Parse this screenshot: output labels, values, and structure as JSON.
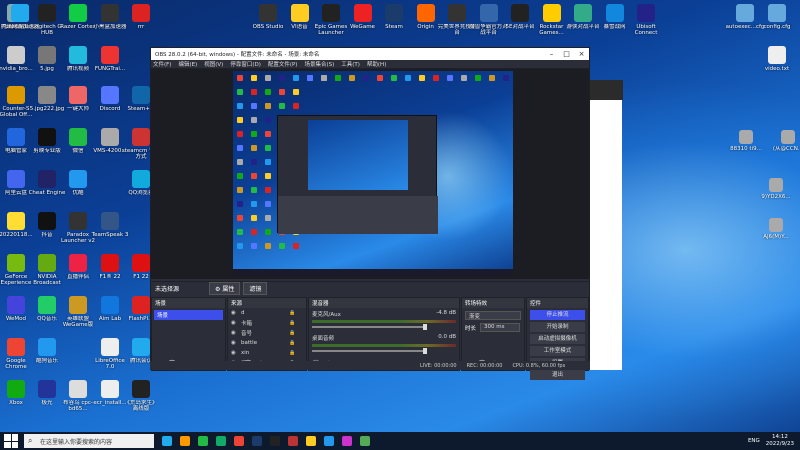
{
  "desktop": {
    "icons": [
      {
        "label": "回收站",
        "x": 0,
        "y": 2,
        "c": "#8aa"
      },
      {
        "label": "Logitech G HUB",
        "x": 1,
        "y": 2,
        "c": "#222"
      },
      {
        "label": "Razer Cortex",
        "x": 2,
        "y": 2,
        "c": "#1c4"
      },
      {
        "label": "小黑盒加速器",
        "x": 3,
        "y": 2,
        "c": "#333"
      },
      {
        "label": "rrr",
        "x": 4,
        "y": 2,
        "c": "#d22"
      },
      {
        "label": "promods...",
        "x": 5,
        "y": 2,
        "c": "#eee"
      },
      {
        "label": "腾讯网游加速器",
        "x": 6,
        "y": 2,
        "c": "#2ae"
      },
      {
        "label": "nvidia_bro...",
        "x": 0,
        "y": 1,
        "c": "#ccc"
      },
      {
        "label": "5.jpg",
        "x": 1,
        "y": 1,
        "c": "#777"
      },
      {
        "label": "腾讯视频",
        "x": 2,
        "y": 1,
        "c": "#2bd"
      },
      {
        "label": "FUNGTrai...",
        "x": 3,
        "y": 1,
        "c": "#e33"
      },
      {
        "label": "Counter-S Global Off...",
        "x": 0,
        "y": 0,
        "c": "#d90"
      },
      {
        "label": "5.jpg222.jpg",
        "x": 1,
        "y": 0,
        "c": "#888"
      },
      {
        "label": "一键大师",
        "x": 2,
        "y": 0,
        "c": "#e66"
      },
      {
        "label": "Discord",
        "x": 3,
        "y": 0,
        "c": "#57f"
      },
      {
        "label": "Steam++",
        "x": 4,
        "y": 0,
        "c": "#16a"
      },
      {
        "label": "电脑管家",
        "x": 0,
        "y": 3,
        "c": "#26d"
      },
      {
        "label": "剪映专业版",
        "x": 1,
        "y": 3,
        "c": "#111"
      },
      {
        "label": "微信",
        "x": 2,
        "y": 3,
        "c": "#2b4"
      },
      {
        "label": "VMS-4200...",
        "x": 3,
        "y": 3,
        "c": "#aaa"
      },
      {
        "label": "steamcm 快捷方式",
        "x": 4,
        "y": 3,
        "c": "#c33"
      },
      {
        "label": "阿里云盘",
        "x": 0,
        "y": 4,
        "c": "#46e"
      },
      {
        "label": "Cheat Engine",
        "x": 1,
        "y": 4,
        "c": "#226"
      },
      {
        "label": "优酷",
        "x": 2,
        "y": 4,
        "c": "#29e"
      },
      {
        "label": "QQ浏览器",
        "x": 4,
        "y": 4,
        "c": "#1ad"
      },
      {
        "label": "20220118...",
        "x": 0,
        "y": 5,
        "c": "#fd3"
      },
      {
        "label": "抖音",
        "x": 1,
        "y": 5,
        "c": "#111"
      },
      {
        "label": "Paradox Launcher v2",
        "x": 2,
        "y": 5,
        "c": "#333"
      },
      {
        "label": "TeamSpeak 3",
        "x": 3,
        "y": 5,
        "c": "#358"
      },
      {
        "label": "GeForce Experience",
        "x": 0,
        "y": 6,
        "c": "#7b1"
      },
      {
        "label": "NVIDIA Broadcast",
        "x": 1,
        "y": 6,
        "c": "#6a1"
      },
      {
        "label": "直播伴侣",
        "x": 2,
        "y": 6,
        "c": "#e24"
      },
      {
        "label": "F1® 22",
        "x": 3,
        "y": 6,
        "c": "#d11"
      },
      {
        "label": "F1 22",
        "x": 4,
        "y": 6,
        "c": "#d11"
      },
      {
        "label": "WeMod",
        "x": 0,
        "y": 7,
        "c": "#44d"
      },
      {
        "label": "QQ音乐",
        "x": 1,
        "y": 7,
        "c": "#2c6"
      },
      {
        "label": "英雄联盟WeGame版",
        "x": 2,
        "y": 7,
        "c": "#c92"
      },
      {
        "label": "Aim Lab",
        "x": 3,
        "y": 7,
        "c": "#17d"
      },
      {
        "label": "FlashPl...",
        "x": 4,
        "y": 7,
        "c": "#d22"
      },
      {
        "label": "Google Chrome",
        "x": 0,
        "y": 8,
        "c": "#e43"
      },
      {
        "label": "酷狗音乐",
        "x": 1,
        "y": 8,
        "c": "#29e"
      },
      {
        "label": "LibreOffice 7.0",
        "x": 3,
        "y": 8,
        "c": "#eee"
      },
      {
        "label": "腾讯会议",
        "x": 4,
        "y": 8,
        "c": "#2ae"
      },
      {
        "label": "Xbox",
        "x": 0,
        "y": 9,
        "c": "#1a1"
      },
      {
        "label": "极光",
        "x": 1,
        "y": 9,
        "c": "#239"
      },
      {
        "label": "布谷鸟 cpc-bd65...",
        "x": 2,
        "y": 9,
        "c": "#ddd"
      },
      {
        "label": "ecr_install...",
        "x": 3,
        "y": 9,
        "c": "#eee"
      },
      {
        "label": "《荒岛求生》 离线版",
        "x": 4,
        "y": 9,
        "c": "#222"
      }
    ],
    "top_icons": [
      {
        "label": "OBS Studio",
        "c": "#333"
      },
      {
        "label": "VI语音",
        "c": "#fc2"
      },
      {
        "label": "Epic Games Launcher",
        "c": "#222"
      },
      {
        "label": "WeGame",
        "c": "#e22"
      },
      {
        "label": "Steam",
        "c": "#1b3b6b"
      },
      {
        "label": "Origin",
        "c": "#f60"
      },
      {
        "label": "完美世界竞技平台",
        "c": "#333"
      },
      {
        "label": "魔兽争霸官方对战平台",
        "c": "#36a"
      },
      {
        "label": "5E对战平台",
        "c": "#222"
      },
      {
        "label": "Rockstar Games...",
        "c": "#fc0"
      },
      {
        "label": "游侠对战平台",
        "c": "#3a8"
      },
      {
        "label": "暴雪战网",
        "c": "#18d"
      },
      {
        "label": "Ubisoft Connect",
        "c": "#228"
      }
    ],
    "right_icons": [
      {
        "label": "autoexec...cfg",
        "c": "#6ad"
      },
      {
        "label": "config.cfg",
        "c": "#6ad"
      },
      {
        "label": "video.txt",
        "c": "#eee"
      }
    ],
    "right_side_texts": [
      "88310 ti9...",
      "(从@CCN...",
      "9)YD2X6...",
      "AJ6(M)Y..."
    ]
  },
  "obs": {
    "title": "OBS 28.0.2 (64-bit, windows) - 配置文件: 未命名 - 场景: 未命名",
    "menu": [
      "文件(F)",
      "编辑(E)",
      "视图(V)",
      "停靠窗口(D)",
      "配置文件(P)",
      "场景集合(S)",
      "工具(T)",
      "帮助(H)"
    ],
    "source_bar": {
      "no_source": "未选择源",
      "props": "属性",
      "filters": "滤镜"
    },
    "scenes": {
      "title": "场景",
      "items": [
        "场景"
      ]
    },
    "sources": {
      "title": "来源",
      "items": [
        "d",
        "卡箱",
        "音号",
        "battle",
        "xin",
        "口"
      ]
    },
    "mixer": {
      "title": "混音器",
      "channels": [
        {
          "name": "麦克风/Aux",
          "db": "-4.8 dB"
        },
        {
          "name": "桌面音频",
          "db": "0.0 dB"
        }
      ]
    },
    "transitions": {
      "title": "转场特效",
      "type": "渐变",
      "duration_label": "时长",
      "duration": "300 ms"
    },
    "controls": {
      "title": "控件",
      "buttons": [
        "停止推流",
        "开始录制",
        "启动虚拟摄像机",
        "工作室模式",
        "设置",
        "退出"
      ]
    },
    "status": {
      "live": "LIVE: 00:00:00",
      "rec": "REC: 00:00:00",
      "cpu": "CPU: 0.8%, 60.00 fps"
    }
  },
  "taskbar": {
    "search_placeholder": "在这里输入你要搜索的内容",
    "lang": "ENG",
    "time": "14:12",
    "date": "2022/9/23"
  }
}
